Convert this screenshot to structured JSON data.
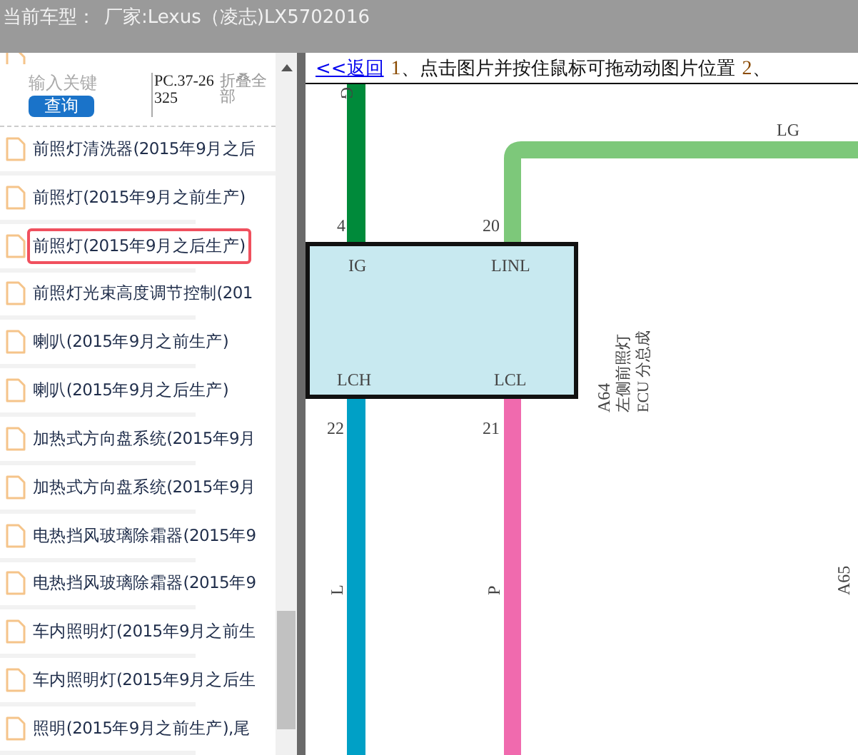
{
  "header": {
    "label": "当前车型：",
    "value": "厂家:Lexus（凌志)LX5702016"
  },
  "search": {
    "placeholder": "输入关键",
    "button": "查询",
    "code": "PC.37-26325",
    "collapse": "折叠全部"
  },
  "items": [
    {
      "label": "前照灯清洗器(2015年9月之后",
      "selected": false
    },
    {
      "label": "前照灯(2015年9月之前生产)",
      "selected": false
    },
    {
      "label": "前照灯(2015年9月之后生产)",
      "selected": true
    },
    {
      "label": "前照灯光束高度调节控制(201",
      "selected": false
    },
    {
      "label": "喇叭(2015年9月之前生产)",
      "selected": false
    },
    {
      "label": "喇叭(2015年9月之后生产)",
      "selected": false
    },
    {
      "label": "加热式方向盘系统(2015年9月",
      "selected": false
    },
    {
      "label": "加热式方向盘系统(2015年9月",
      "selected": false
    },
    {
      "label": "电热挡风玻璃除霜器(2015年9",
      "selected": false
    },
    {
      "label": "电热挡风玻璃除霜器(2015年9",
      "selected": false
    },
    {
      "label": "车内照明灯(2015年9月之前生",
      "selected": false
    },
    {
      "label": "车内照明灯(2015年9月之后生",
      "selected": false
    },
    {
      "label": "照明(2015年9月之前生产),尾",
      "selected": false
    }
  ],
  "content": {
    "back_link": "<<返回",
    "hint_number": "1",
    "hint": "、点击图片并按住鼠标可拖动动图片位置",
    "hint_number_2": "2",
    "hint_2": "、"
  },
  "diagram": {
    "wires": [
      {
        "name": "G",
        "pin": "4",
        "color": "#008a3a"
      },
      {
        "name": "LG",
        "pin": "20",
        "color": "#7dc87a"
      },
      {
        "name": "L",
        "pin": "22",
        "color": "#00a0c6"
      },
      {
        "name": "P",
        "pin": "21",
        "color": "#f06aae"
      }
    ],
    "terminals": [
      "IG",
      "LINL",
      "LCH",
      "LCL"
    ],
    "component": {
      "code": "A64",
      "name": "左侧前照灯",
      "name_2": "ECU 分总成"
    },
    "next_component": "A65"
  }
}
